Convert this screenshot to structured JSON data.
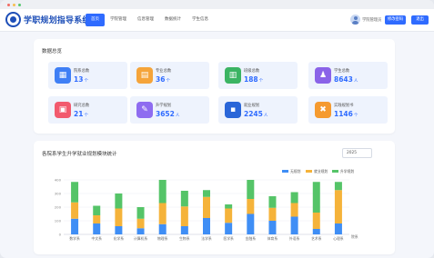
{
  "window": {
    "dots": [
      "#f26b63",
      "#f7be4f",
      "#54c66d"
    ]
  },
  "header": {
    "title": "学职规划指导系统",
    "nav": [
      {
        "label": "首页",
        "active": true
      },
      {
        "label": "学院管理",
        "active": false
      },
      {
        "label": "信息管理",
        "active": false
      },
      {
        "label": "数据统计",
        "active": false
      },
      {
        "label": "学生信息",
        "active": false
      }
    ],
    "user_name": "学院管理员",
    "button_password": "修改密码",
    "button_logout": "退出"
  },
  "overview": {
    "title": "数据总览",
    "stats": [
      {
        "label": "院系总数",
        "value": "13",
        "unit": "个",
        "color": "#3f7ff5",
        "icon": "building-icon",
        "glyph": "▦"
      },
      {
        "label": "专业总数",
        "value": "36",
        "unit": "个",
        "color": "#f5a43a",
        "icon": "book-icon",
        "glyph": "▤"
      },
      {
        "label": "班级总数",
        "value": "188",
        "unit": "个",
        "color": "#3bb463",
        "icon": "class-icon",
        "glyph": "▥"
      },
      {
        "label": "学生总数",
        "value": "8643",
        "unit": "人",
        "color": "#8a63e8",
        "icon": "students-icon",
        "glyph": "♟"
      },
      {
        "label": "研究总数",
        "value": "21",
        "unit": "个",
        "color": "#f25a6e",
        "icon": "research-icon",
        "glyph": "▣"
      },
      {
        "label": "升学规划",
        "value": "3652",
        "unit": "人",
        "color": "#8e6cf0",
        "icon": "graduation-cap-icon",
        "glyph": "✎"
      },
      {
        "label": "就业规划",
        "value": "2245",
        "unit": "人",
        "color": "#2a66d8",
        "icon": "briefcase-icon",
        "glyph": "▪"
      },
      {
        "label": "实践规划书",
        "value": "1146",
        "unit": "个",
        "color": "#f59a2f",
        "icon": "tools-icon",
        "glyph": "✖"
      }
    ]
  },
  "chart_section": {
    "title": "各院系学生升学就业规划模块统计",
    "year": "2025"
  },
  "chart_data": {
    "type": "bar",
    "stacked": true,
    "categories": [
      "数学系",
      "中文系",
      "化学系",
      "计算机系",
      "物理系",
      "生物系",
      "法学系",
      "医学系",
      "金融系",
      "体育系",
      "外语系",
      "艺术系",
      "心理系"
    ],
    "series": [
      {
        "name": "无规划",
        "color": "#3f8ef5",
        "values": [
          115,
          80,
          60,
          45,
          75,
          60,
          120,
          85,
          150,
          100,
          130,
          40,
          80
        ]
      },
      {
        "name": "就业规划",
        "color": "#f5b33a",
        "values": [
          120,
          60,
          130,
          70,
          155,
          145,
          155,
          105,
          110,
          95,
          100,
          120,
          245
        ]
      },
      {
        "name": "升学规划",
        "color": "#55c468",
        "values": [
          150,
          70,
          110,
          85,
          170,
          115,
          50,
          30,
          140,
          85,
          80,
          225,
          60
        ]
      }
    ],
    "ylim": [
      0,
      500
    ],
    "yticks": [
      0,
      100,
      200,
      300,
      400
    ],
    "xlabel": "院系",
    "legend_position": "top-right",
    "grid": true
  }
}
